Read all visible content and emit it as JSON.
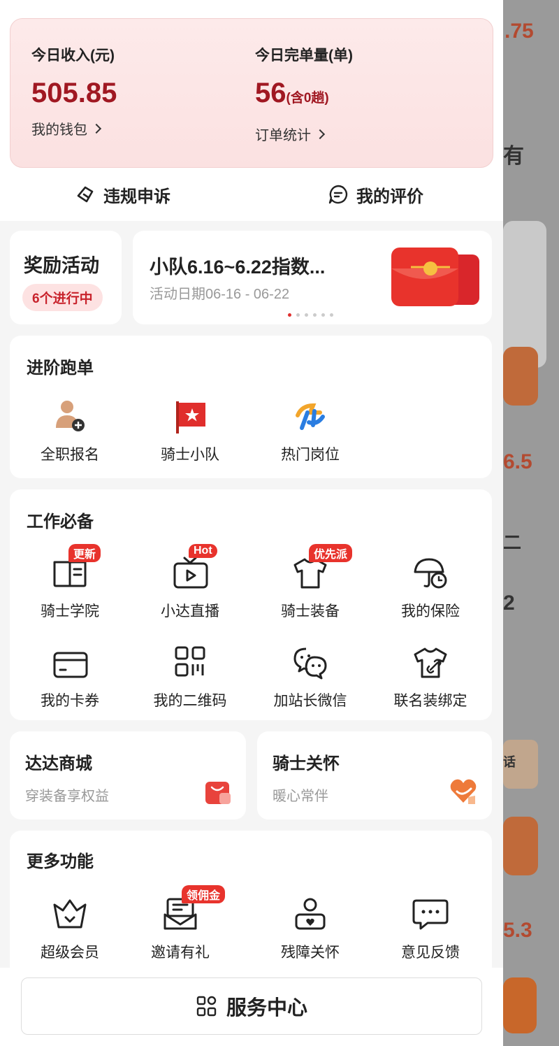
{
  "income": {
    "today_income_label": "今日收入(元)",
    "today_income_value": "505.85",
    "wallet_link": "我的钱包",
    "today_orders_label": "今日完单量(单)",
    "today_orders_value": "56",
    "today_orders_note": "(含0趟)",
    "order_stats_link": "订单统计"
  },
  "quick_actions": {
    "appeal": "违规申诉",
    "rating": "我的评价"
  },
  "reward": {
    "label": "奖励活动",
    "badge": "6个进行中",
    "banner_title": "小队6.16~6.22指数...",
    "banner_date": "活动日期06-16 - 06-22"
  },
  "advanced": {
    "title": "进阶跑单",
    "items": [
      "全职报名",
      "骑士小队",
      "热门岗位"
    ]
  },
  "work": {
    "title": "工作必备",
    "items": [
      {
        "label": "骑士学院",
        "tag": "更新",
        "icon": "book-icon"
      },
      {
        "label": "小达直播",
        "tag": "Hot",
        "icon": "tv-play-icon"
      },
      {
        "label": "骑士装备",
        "tag": "优先派",
        "icon": "tshirt-icon"
      },
      {
        "label": "我的保险",
        "tag": "",
        "icon": "umbrella-clock-icon"
      },
      {
        "label": "我的卡券",
        "tag": "",
        "icon": "card-icon"
      },
      {
        "label": "我的二维码",
        "tag": "",
        "icon": "qrcode-icon"
      },
      {
        "label": "加站长微信",
        "tag": "",
        "icon": "wechat-icon"
      },
      {
        "label": "联名装绑定",
        "tag": "",
        "icon": "tshirt-link-icon"
      }
    ]
  },
  "mall": {
    "title": "达达商城",
    "subtitle": "穿装备享权益"
  },
  "care": {
    "title": "骑士关怀",
    "subtitle": "暖心常伴"
  },
  "more": {
    "title": "更多功能",
    "items": [
      {
        "label": "超级会员",
        "tag": "",
        "icon": "crown-icon"
      },
      {
        "label": "邀请有礼",
        "tag": "领佣金",
        "icon": "mail-invite-icon"
      },
      {
        "label": "残障关怀",
        "tag": "",
        "icon": "person-heart-icon"
      },
      {
        "label": "意见反馈",
        "tag": "",
        "icon": "feedback-icon"
      }
    ]
  },
  "service_center": "服务中心",
  "background_fragments": [
    ".75",
    "有",
    "6.5",
    "二",
    "2",
    "话",
    "5.3"
  ],
  "colors": {
    "accent": "#a01822",
    "tag_red": "#e8332c",
    "card_pink": "#fdeaea"
  }
}
